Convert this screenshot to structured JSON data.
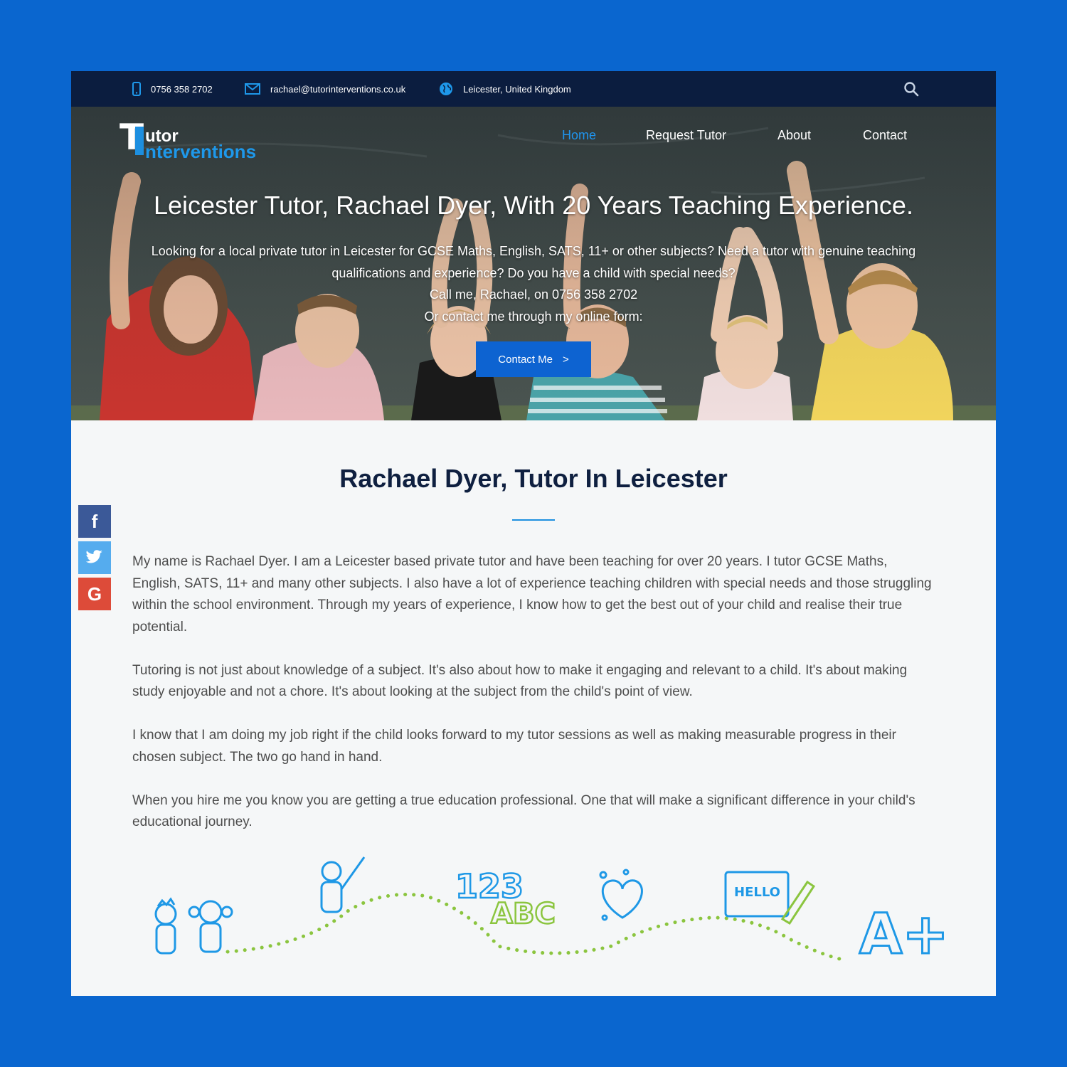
{
  "topbar": {
    "phone": "0756 358 2702",
    "email": "rachael@tutorinterventions.co.uk",
    "location": "Leicester, United Kingdom",
    "icons": [
      "phone-icon",
      "mail-icon",
      "globe-icon",
      "search-icon"
    ]
  },
  "logo": {
    "letter_t": "T",
    "word1": "utor",
    "word2": "nterventions"
  },
  "nav": {
    "items": [
      {
        "label": "Home",
        "active": true
      },
      {
        "label": "Request Tutor",
        "active": false
      },
      {
        "label": "About",
        "active": false
      },
      {
        "label": "Contact",
        "active": false
      }
    ]
  },
  "hero": {
    "title": "Leicester Tutor, Rachael Dyer, With 20 Years Teaching Experience.",
    "lines": [
      "Looking for a local private tutor in Leicester for GCSE Maths, English, SATS, 11+ or other subjects? Need a tutor with genuine teaching qualifications and experience? Do you have a child with special needs?",
      "Call me, Rachael, on 0756 358 2702",
      "Or contact me through my online form:"
    ],
    "cta_label": "Contact Me",
    "cta_chevron": ">"
  },
  "content": {
    "heading": "Rachael Dyer, Tutor In Leicester",
    "paragraphs": [
      "My name is Rachael Dyer. I am a Leicester based private tutor and have been teaching for over 20 years. I tutor GCSE Maths, English, SATS, 11+ and many other subjects. I also have a lot of experience teaching children with special needs and those struggling within the school environment. Through my years of experience, I know how to get the best out of your child and realise their true potential.",
      "Tutoring is not just about knowledge of a subject. It's also about how to make it engaging and relevant to a child. It's about making study enjoyable and not a chore. It's about looking at the subject from the child's point of view.",
      "I know that I am doing my job right if the child looks forward to my tutor sessions as well as making measurable progress in their chosen subject. The two go hand in hand.",
      "When you hire me you know you are getting a true education professional. One that will make a significant difference in your child's educational journey."
    ]
  },
  "social": {
    "facebook": "f",
    "google": "G"
  },
  "doodles": {
    "numbers": "123",
    "letters": "ABC",
    "hello": "HELLO",
    "grade": "A+"
  },
  "colors": {
    "page_background": "#0a66cf",
    "topbar": "#0b1d3f",
    "accent": "#1f95ef",
    "cta": "#0d63d1",
    "heading": "#0f2040",
    "facebook": "#3b5998",
    "twitter": "#55acee",
    "google": "#dd4b39",
    "doodle_blue": "#1e98e6",
    "doodle_green": "#8bc53f"
  }
}
